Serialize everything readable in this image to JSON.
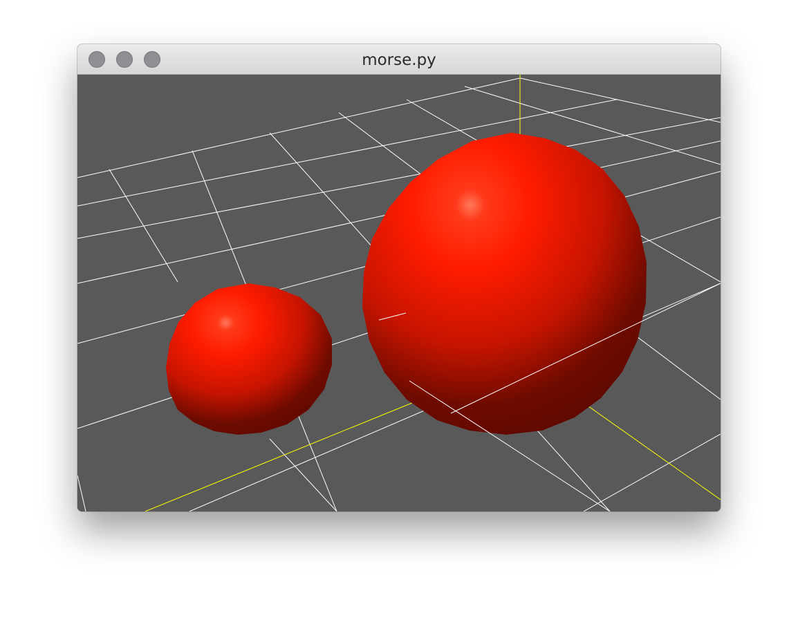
{
  "window": {
    "title": "morse.py"
  },
  "scene": {
    "background_color": "#595959",
    "grid_color": "#ffffff",
    "axis_color": "#ffff00",
    "sphere_color": "#ff1a00",
    "sphere_count": 2
  },
  "icons": {
    "close": "traffic-light-close",
    "minimize": "traffic-light-minimize",
    "zoom": "traffic-light-zoom"
  }
}
